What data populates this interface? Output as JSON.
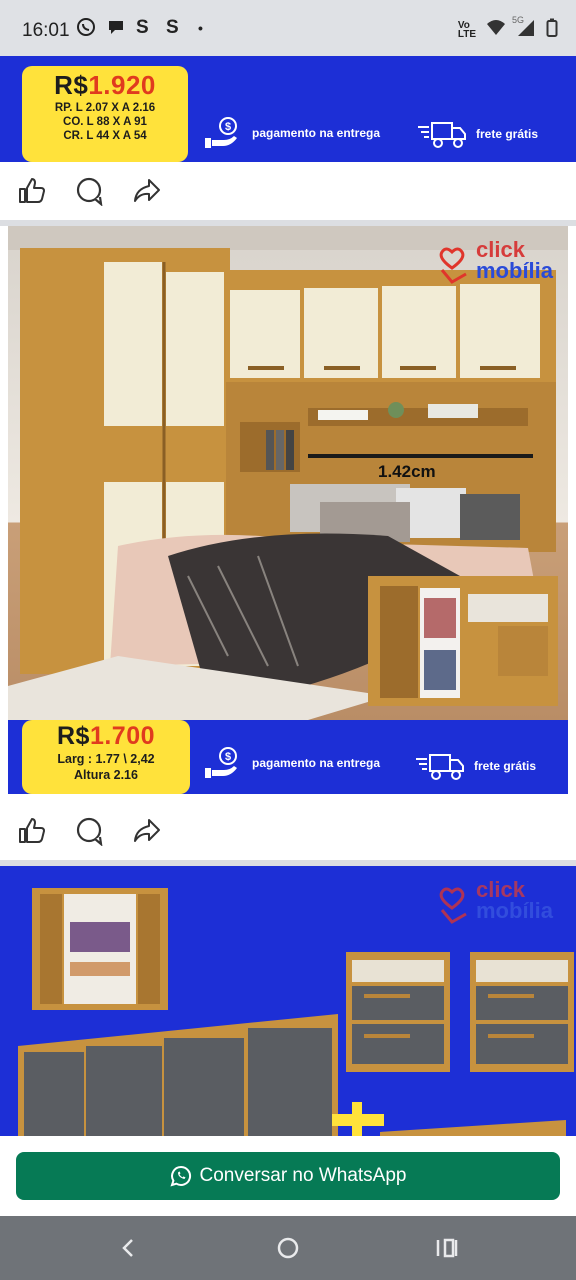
{
  "status_bar": {
    "time": "16:01",
    "app_icons": [
      "whatsapp-icon",
      "chat-icon",
      "s-icon",
      "s-icon"
    ],
    "s1": "S",
    "s2": "S",
    "dot": "•",
    "volte": "Vo\nLTE",
    "net": "5G"
  },
  "post1": {
    "price_prefix": "R$",
    "price_value": "1.920",
    "dims": [
      "RP. L 2.07 X A 2.16",
      "CO. L 88 X A 91",
      "CR. L 44 X A 54"
    ],
    "payment_label": "pagamento na entrega",
    "shipping_label": "frete grátis"
  },
  "post2": {
    "brand_line1": "click",
    "brand_line2": "mobília",
    "measure_label": "1.42cm",
    "price_prefix": "R$",
    "price_value": "1.700",
    "width_label": "Larg : 1.77 \\ 2,42",
    "height_label": "Altura 2.16",
    "payment_label": "pagamento na entrega",
    "shipping_label": "frete grátis"
  },
  "post3": {
    "brand_line1": "click",
    "brand_line2": "mobília"
  },
  "whatsapp_button": {
    "label": "Conversar no WhatsApp"
  },
  "colors": {
    "banner_blue": "#1d2fd6",
    "price_yellow": "#ffe23b",
    "price_red": "#e03b1e",
    "whatsapp_green": "#067a55",
    "wood": "#c7923f",
    "cream": "#f2ecd6"
  }
}
